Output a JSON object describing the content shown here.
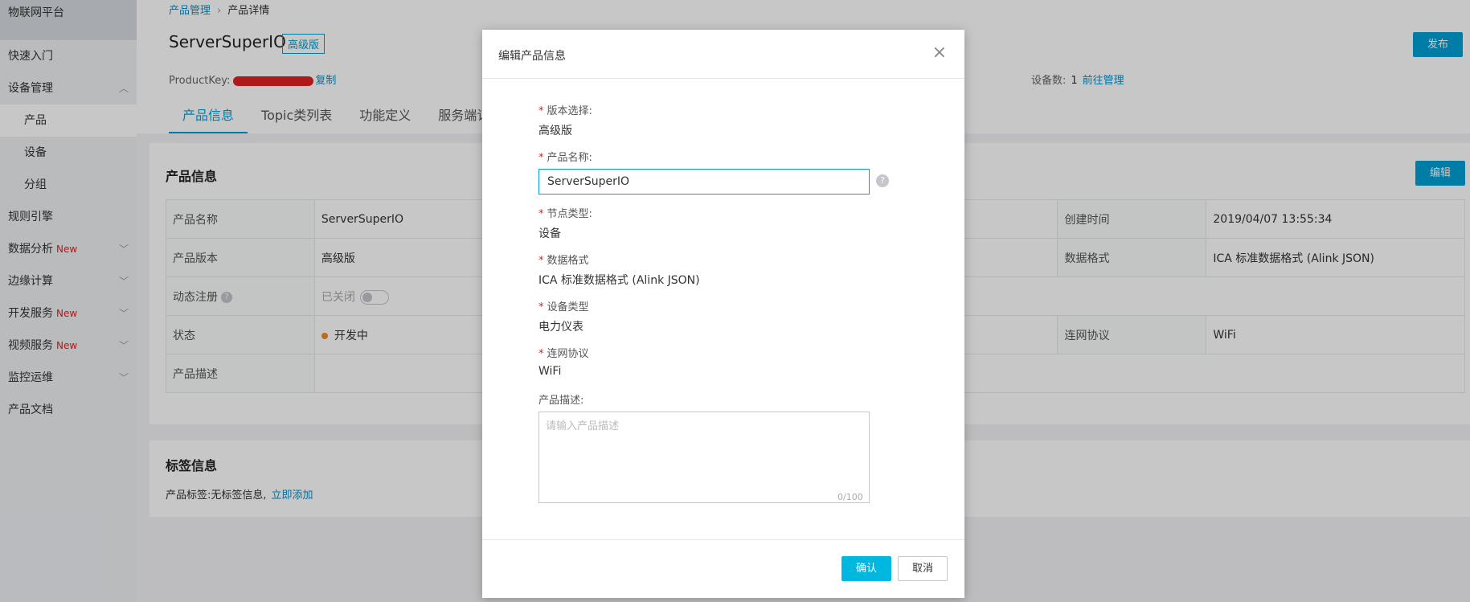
{
  "sidebar": {
    "brand": "物联网平台",
    "items": [
      {
        "label": "快速入门",
        "new": "",
        "chevron": false
      },
      {
        "label": "设备管理",
        "new": "",
        "chevron": true
      },
      {
        "label": "产品",
        "new": "",
        "chevron": false
      },
      {
        "label": "设备",
        "new": "",
        "chevron": false
      },
      {
        "label": "分组",
        "new": "",
        "chevron": false
      },
      {
        "label": "规则引擎",
        "new": "",
        "chevron": false
      },
      {
        "label": "数据分析",
        "new": "New",
        "chevron": true
      },
      {
        "label": "边缘计算",
        "new": "",
        "chevron": true
      },
      {
        "label": "开发服务",
        "new": "New",
        "chevron": true
      },
      {
        "label": "视频服务",
        "new": "New",
        "chevron": true
      },
      {
        "label": "监控运维",
        "new": "",
        "chevron": true
      },
      {
        "label": "产品文档",
        "new": "",
        "chevron": false
      }
    ]
  },
  "header": {
    "breadcrumb_root": "产品管理",
    "breadcrumb_sep": "›",
    "breadcrumb_current": "产品详情",
    "product_name": "ServerSuperIO",
    "edition": "高级版",
    "productkey_label": "ProductKey:",
    "copy_label": "复制",
    "device_count_label": "设备数:",
    "device_count": "1",
    "manage_link": "前往管理",
    "publish_label": "发布",
    "tabs": [
      "产品信息",
      "Topic类列表",
      "功能定义",
      "服务端订"
    ]
  },
  "product_info": {
    "title": "产品信息",
    "edit_label": "编辑",
    "rows": [
      {
        "l1": "产品名称",
        "v1": "ServerSuperIO",
        "l2": "创建时间",
        "v2": "2019/04/07 13:55:34"
      },
      {
        "l1": "产品版本",
        "v1": "高级版",
        "l2": "数据格式",
        "v2": "ICA 标准数据格式 (Alink JSON)"
      },
      {
        "l1": "动态注册",
        "v1": "已关闭",
        "l2": "",
        "v2": ""
      },
      {
        "l1": "状态",
        "v1": "开发中",
        "l2": "连网协议",
        "v2": "WiFi"
      },
      {
        "l1": "产品描述",
        "v1": "",
        "l2": "",
        "v2": ""
      }
    ]
  },
  "tags": {
    "title": "标签信息",
    "label": "产品标签:无标签信息,",
    "add_link": "立即添加"
  },
  "modal": {
    "title": "编辑产品信息",
    "close_icon": "×",
    "edition_label": "版本选择:",
    "edition_value": "高级版",
    "name_label": "产品名称:",
    "name_value": "ServerSuperIO",
    "node_label": "节点类型:",
    "node_value": "设备",
    "format_label": "数据格式",
    "format_value": "ICA 标准数据格式 (Alink JSON)",
    "device_type_label": "设备类型",
    "device_type_value": "电力仪表",
    "protocol_label": "连网协议",
    "protocol_value": "WiFi",
    "desc_label": "产品描述:",
    "desc_placeholder": "请输入产品描述",
    "desc_count": "0/100",
    "ok_label": "确认",
    "cancel_label": "取消"
  },
  "colors": {
    "accent": "#00a1d6",
    "required": "#e02020",
    "status_dot": "#f08a24"
  }
}
